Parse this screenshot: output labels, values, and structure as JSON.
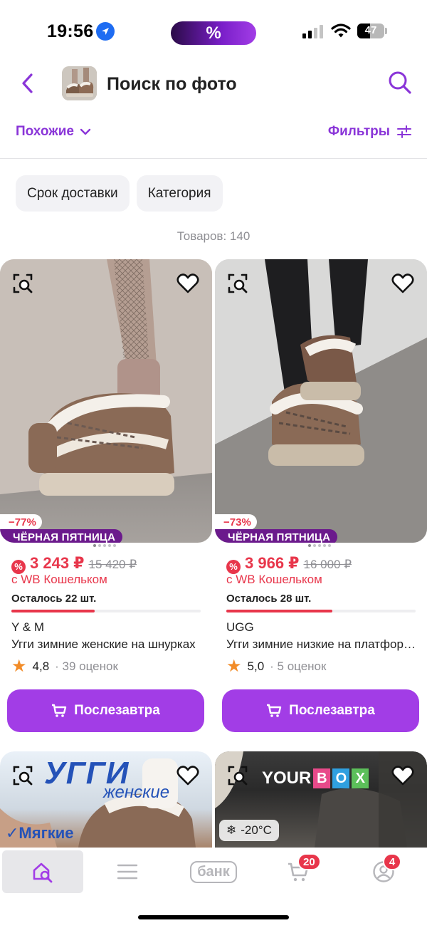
{
  "status_bar": {
    "time": "19:56",
    "promo_symbol": "%",
    "battery_level": 47,
    "battery_text": "47",
    "location_icon": "location-arrow-icon",
    "signal_icon": "cellular-signal-icon",
    "wifi_icon": "wifi-icon"
  },
  "header": {
    "title": "Поиск по фото",
    "back_icon": "chevron-left-icon",
    "search_icon": "search-icon"
  },
  "toolbar": {
    "sort_label": "Похожие",
    "filters_label": "Фильтры"
  },
  "chips": [
    {
      "label": "Срок доставки"
    },
    {
      "label": "Категория"
    }
  ],
  "results_count": "Товаров: 140",
  "products": [
    {
      "discount": "−77%",
      "promo_badge": "ЧЁРНАЯ ПЯТНИЦА",
      "price": "3 243 ₽",
      "old_price": "15 420 ₽",
      "wallet_text": "с WB Кошельком",
      "stock_text": "Осталось 22 шт.",
      "stock_fraction": 0.44,
      "brand": "Y & M",
      "name": "Угги зимние женские на шнурках",
      "rating": "4,8",
      "reviews": "· 39 оценок",
      "button_label": "Послезавтра"
    },
    {
      "discount": "−73%",
      "promo_badge": "ЧЁРНАЯ ПЯТНИЦА",
      "price": "3 966 ₽",
      "old_price": "16 000 ₽",
      "wallet_text": "с WB Кошельком",
      "stock_text": "Осталось 28 шт.",
      "stock_fraction": 0.56,
      "brand": "UGG",
      "name": "Угги зимние низкие на платформе",
      "rating": "5,0",
      "reviews": "· 5 оценок",
      "button_label": "Послезавтра"
    }
  ],
  "partial_products": [
    {
      "title": "УГГИ",
      "subtitle": "женские",
      "feature": "✓Мягкие"
    },
    {
      "brand_word": "YOUR",
      "brand_letters": [
        "B",
        "O",
        "X"
      ],
      "temperature": "-20°C"
    }
  ],
  "bottom_nav": {
    "bank_label": "банк",
    "cart_count": "20",
    "profile_count": "4"
  },
  "colors": {
    "accent": "#a23de6",
    "accent_text": "#8a35d8",
    "sale_red": "#e8364b",
    "black_friday": "#6b1a8c"
  }
}
